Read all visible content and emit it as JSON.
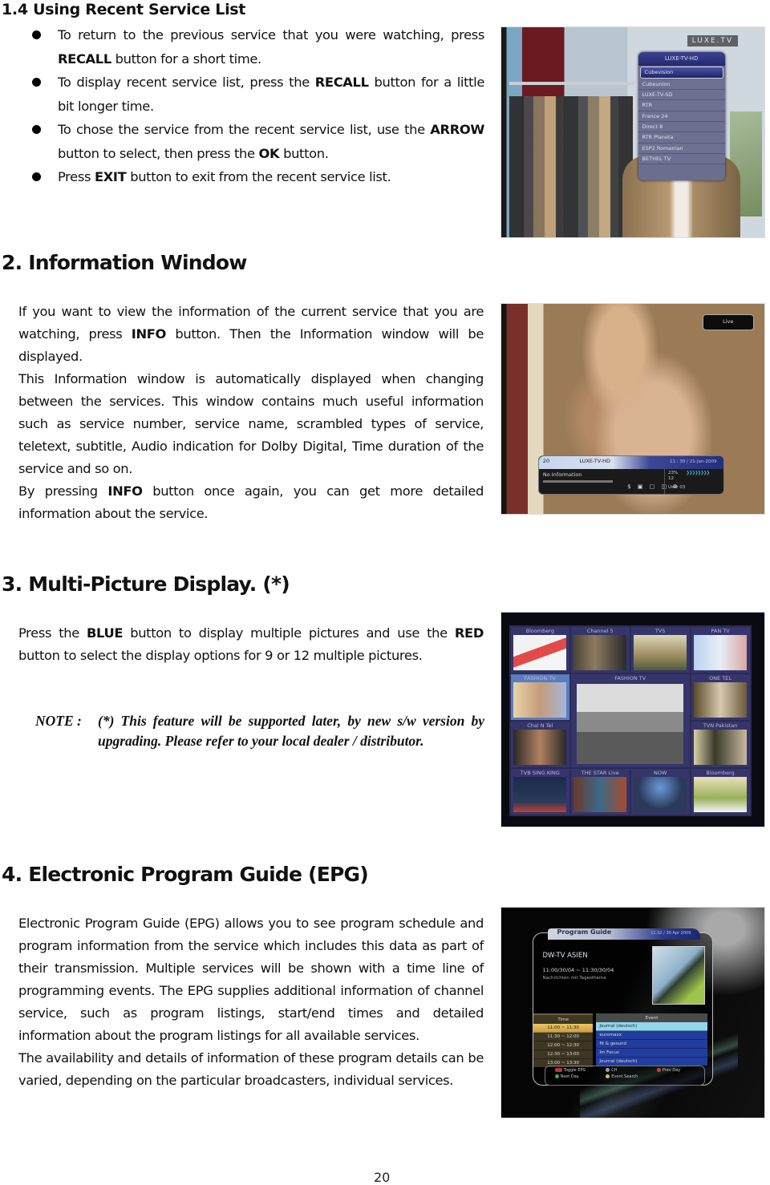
{
  "section_1_4": {
    "heading": "1.4  Using Recent Service List",
    "bullets": [
      {
        "parts": [
          "To return to the previous service that you were watching, press ",
          "RECALL",
          " button for a short time."
        ]
      },
      {
        "parts": [
          "To display recent service list, press the ",
          "RECALL",
          " button for a little bit longer time."
        ]
      },
      {
        "parts": [
          "To chose the service from the recent service list, use the ",
          "ARROW",
          " button to select, then press the ",
          "OK",
          " button."
        ]
      },
      {
        "parts": [
          "Press ",
          "EXIT",
          " button to exit from the recent service list."
        ]
      }
    ],
    "screenshot": {
      "logo": "LUXE.TV",
      "panel_title": "LUXE-TV-HD",
      "services": [
        "Cubevision",
        "Cubeunion",
        "LUXE-TV-SD",
        "RTR",
        "France 24",
        "Direct 8",
        "RTR Planeta",
        "ESP2 Romanian",
        "BETHEL TV"
      ],
      "selected_index": 0
    }
  },
  "section_2": {
    "heading": "2. Information Window",
    "p1": [
      "If you want to view the information of the current service that you are watching, press ",
      "INFO",
      " button. Then the Information window will be displayed."
    ],
    "p2": "This Information window is automatically displayed when changing between the services.  This window contains much useful information such as service number, service name, scrambled types of service, teletext, subtitle, Audio indication for Dolby Digital, Time duration of the service and so on.",
    "p3": [
      "By pressing ",
      "INFO",
      " button once again, you can get more detailed information about the service."
    ],
    "screenshot": {
      "live_badge": "Live",
      "channel_number": "20",
      "channel_name": "LUXE-TV-HD",
      "datetime": "11 : 30 / 21-Jan-2009",
      "event_text": "No Information",
      "signal_percent": "23%",
      "signal_sub": "12",
      "user": "User 03",
      "status_icons": "$ ▣ ▢ ◫ ⧉",
      "chevrons": "❯❯❯❯❯❯❯❯"
    }
  },
  "section_3": {
    "heading": "3. Multi-Picture Display. (*)",
    "p1": [
      "Press the ",
      "BLUE",
      " button to display multiple pictures and use the ",
      "RED",
      " button to select the display options for 9 or 12 multiple pictures."
    ],
    "note_label": "NOTE :",
    "note_text": "(*) This feature will be supported later, by new s/w version by upgrading.  Please refer to your local dealer / distributor.",
    "screenshot": {
      "cells": [
        "Bloomberg",
        "Channel 5",
        "TV5",
        "PAN TV",
        "FASHION TV",
        "FASHION TV",
        "ONE TEL",
        "Chal N Tel",
        "TVN Pakistan",
        "TVB SING KING",
        "THE STAR Live",
        "NOW",
        "Bloomberg"
      ]
    }
  },
  "section_4": {
    "heading": "4. Electronic Program Guide (EPG)",
    "p1": "Electronic Program Guide (EPG) allows you to see program schedule and program information from the service which includes this data as part of their transmission. Multiple services will be shown with a time line of programming events. The EPG supplies additional information of channel service, such as program listings, start/end times and detailed information about the program listings for all available services.",
    "p2": "The availability and details of information of these program details can be varied, depending on the particular broadcasters, individual services.",
    "screenshot": {
      "title": "Program Guide",
      "datetime": "11:32 / 30 Apr 2009",
      "channel": "DW-TV ASIEN",
      "event_time": "11:00/30/04 ~ 11:30/30/04",
      "event_desc": "Nachrichten mit Tagesthema",
      "time_header": "Time",
      "event_header": "Event",
      "rows": [
        {
          "time": "11:00 ~ 11:30",
          "event": "Journal (deutsch)"
        },
        {
          "time": "11:30 ~ 12:00",
          "event": "euromaxx"
        },
        {
          "time": "12:00 ~ 12:30",
          "event": "fit & gesund"
        },
        {
          "time": "12:30 ~ 13:00",
          "event": "Im Focus"
        },
        {
          "time": "13:00 ~ 13:30",
          "event": "Journal (deutsch)"
        }
      ],
      "selected_row": 0,
      "legend": {
        "toggle": "Toggle EPG",
        "ch": "CH",
        "prev": "Prev Day",
        "next": "Next Day",
        "search": "Event Search"
      },
      "legend_colors": {
        "toggle": "#c0304a",
        "ch": "#8aa6d8",
        "prev": "#d04040",
        "next": "#3fae4a",
        "search": "#e0c040"
      }
    }
  },
  "page_number": "20"
}
